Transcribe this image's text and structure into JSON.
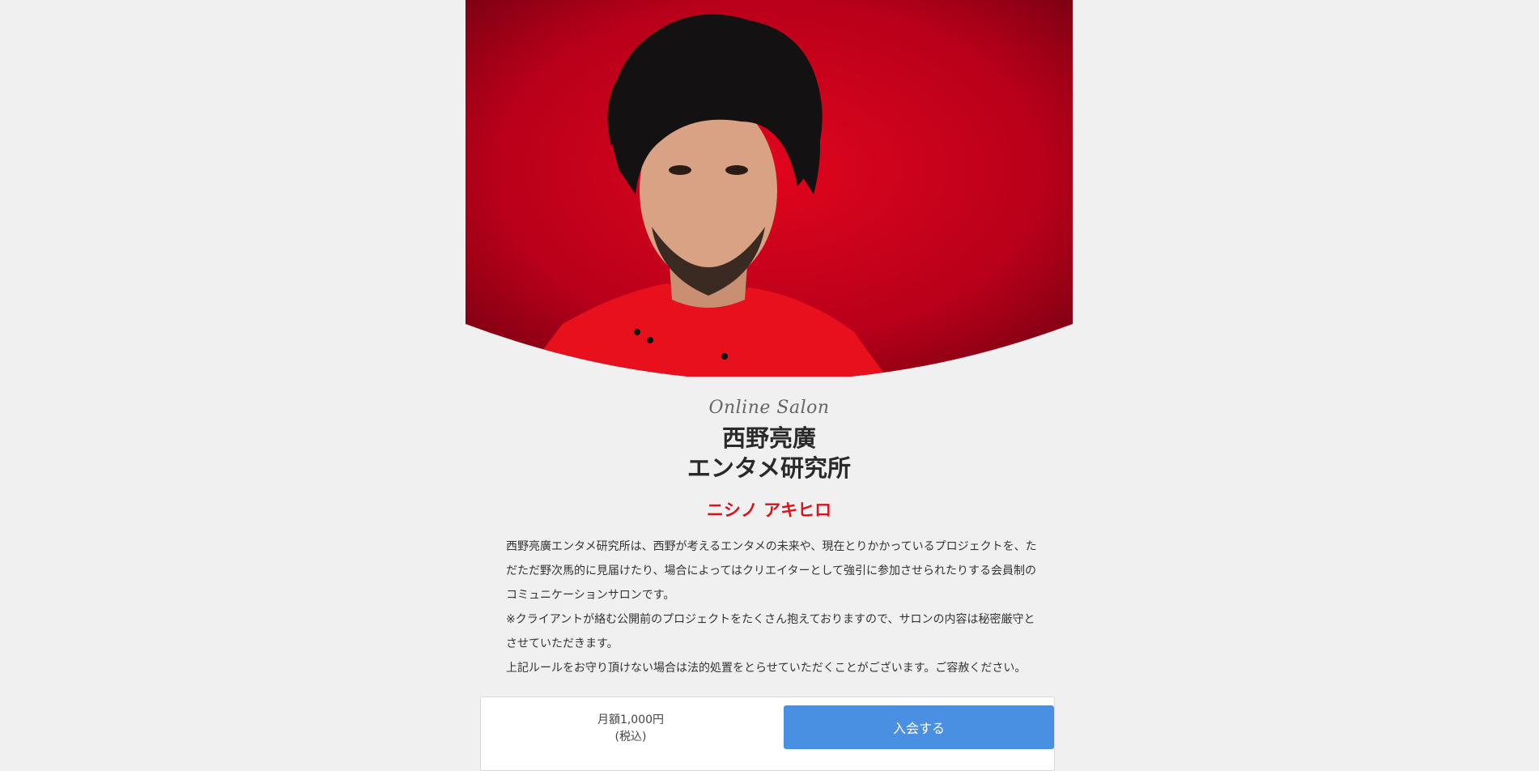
{
  "salon": {
    "subtitle": "Online Salon",
    "title_line1": "西野亮廣",
    "title_line2": "エンタメ研究所",
    "owner": "ニシノ アキヒロ",
    "description": [
      "西野亮廣エンタメ研究所は、西野が考えるエンタメの未来や、現在とりかかっているプロジェクトを、ただただ野次馬的に見届けたり、場合によってはクリエイターとして強引に参加させられたりする会員制のコミュニケーションサロンです。",
      "※クライアントが絡む公開前のプロジェクトをたくさん抱えておりますので、サロンの内容は秘密厳守とさせていただきます。",
      "上記ルールをお守り頂けない場合は法的処置をとらせていただくことがございます。ご容赦ください。"
    ]
  },
  "join": {
    "price": "月額1,000円",
    "tax_note": "(税込)",
    "button_label": "入会する"
  },
  "colors": {
    "hero_red": "#c8001a",
    "owner_red": "#d7141c",
    "button_blue": "#4a90e2"
  }
}
